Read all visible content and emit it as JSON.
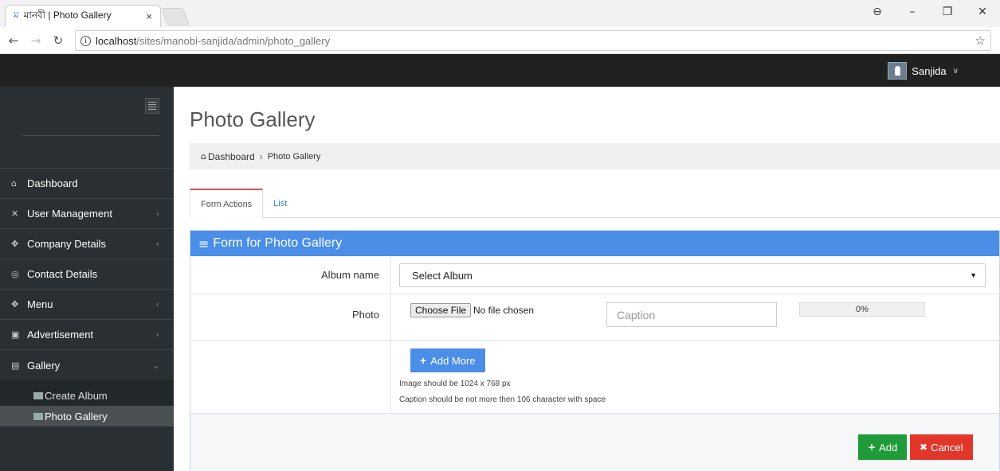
{
  "browser": {
    "tab_title": "মানবী | Photo Gallery",
    "tab_icon": "ম",
    "tab_close": "×",
    "url_host": "localhost",
    "url_path": "/sites/manobi-sanjida/admin/photo_gallery"
  },
  "header": {
    "user_name": "Sanjida"
  },
  "sidebar": {
    "items": [
      {
        "label": "Dashboard",
        "icon": "home-icon",
        "glyph": "⌂"
      },
      {
        "label": "User Management",
        "icon": "expand-icon",
        "glyph": "✕"
      },
      {
        "label": "Company Details",
        "icon": "company-icon",
        "glyph": "✥"
      },
      {
        "label": "Contact Details",
        "icon": "contact-icon",
        "glyph": "◎"
      },
      {
        "label": "Menu",
        "icon": "menu-icon",
        "glyph": "✥"
      },
      {
        "label": "Advertisement",
        "icon": "advert-icon",
        "glyph": "▣"
      },
      {
        "label": "Gallery",
        "icon": "gallery-icon",
        "glyph": "▤"
      }
    ],
    "sub_items": [
      {
        "label": "Create Album"
      },
      {
        "label": "Photo Gallery"
      }
    ]
  },
  "main": {
    "title": "Photo Gallery",
    "breadcrumb": {
      "home": "Dashboard",
      "sep": "›",
      "current": "Photo Gallery"
    },
    "tabs": [
      {
        "label": "Form Actions",
        "active": true
      },
      {
        "label": "List",
        "active": false
      }
    ],
    "panel_title": "Form for Photo Gallery",
    "form": {
      "album_label": "Album name",
      "album_value": "Select Album",
      "photo_label": "Photo",
      "choose_file": "Choose File",
      "no_file": "No file chosen",
      "caption_placeholder": "Caption",
      "progress": "0%",
      "progress_value": 0,
      "add_more": "Add More",
      "hint_size": "Image should be 1024 x 768 px",
      "hint_caption": "Caption should be not more then 106 character with space"
    },
    "buttons": {
      "add": "Add",
      "cancel": "Cancel"
    }
  },
  "colors": {
    "accent": "#4a8ee8",
    "add": "#1f9b3a",
    "cancel": "#e2362a",
    "sidebar": "#2a2f33",
    "topbar": "#212121"
  }
}
